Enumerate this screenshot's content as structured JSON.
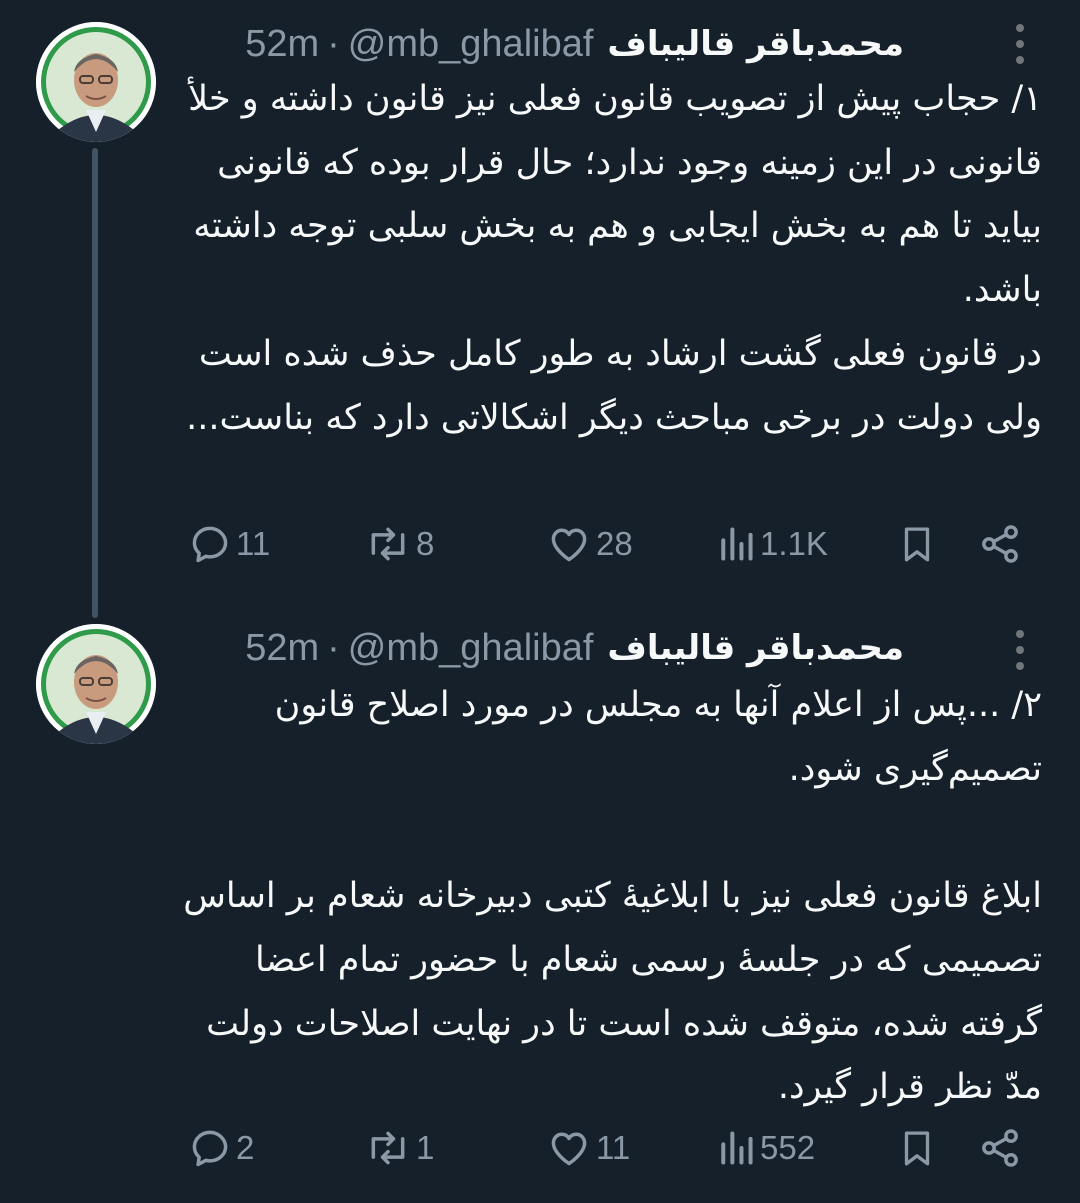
{
  "tweets": [
    {
      "author_name": "محمدباقر قالیباف",
      "handle": "@mb_ghalibaf",
      "separator": "·",
      "time": "52m",
      "paragraphs": [
        "۱/ حجاب پیش از تصویب قانون فعلی نیز قانون داشته و خلأ قانونی در این زمینه وجود ندارد؛ حال قرار بوده که قانونی بیاید تا هم به بخش ایجابی و هم به بخش سلبی توجه داشته باشد.",
        "در قانون فعلی گشت ارشاد به طور کامل حذف شده است ولی دولت در برخی مباحث دیگر اشکالاتی دارد که بناست..."
      ],
      "stats": {
        "replies": "11",
        "reposts": "8",
        "likes": "28",
        "views": "1.1K"
      }
    },
    {
      "author_name": "محمدباقر قالیباف",
      "handle": "@mb_ghalibaf",
      "separator": "·",
      "time": "52m",
      "paragraphs": [
        "۲/ ...پس از اعلام آنها به مجلس در مورد اصلاح قانون تصمیم‌گیری شود.",
        "ابلاغ قانون فعلی نیز با ابلاغیهٔ کتبی دبیرخانه شعام بر اساس تصمیمی که در جلسهٔ رسمی شعام با حضور تمام اعضا گرفته شده، متوقف شده است تا در نهایت اصلاحات دولت مدّ نظر قرار گیرد."
      ],
      "stats": {
        "replies": "2",
        "reposts": "1",
        "likes": "11",
        "views": "552"
      }
    }
  ],
  "icons": {
    "reply": "reply-icon",
    "repost": "repost-icon",
    "like": "heart-icon",
    "views": "views-icon",
    "bookmark": "bookmark-icon",
    "share": "share-icon",
    "more": "more-icon"
  },
  "colors": {
    "background": "#15202b",
    "text": "#f7f9f9",
    "secondary": "#8b98a5",
    "thread_line": "#425364",
    "avatar_ring": "#ffffff"
  }
}
